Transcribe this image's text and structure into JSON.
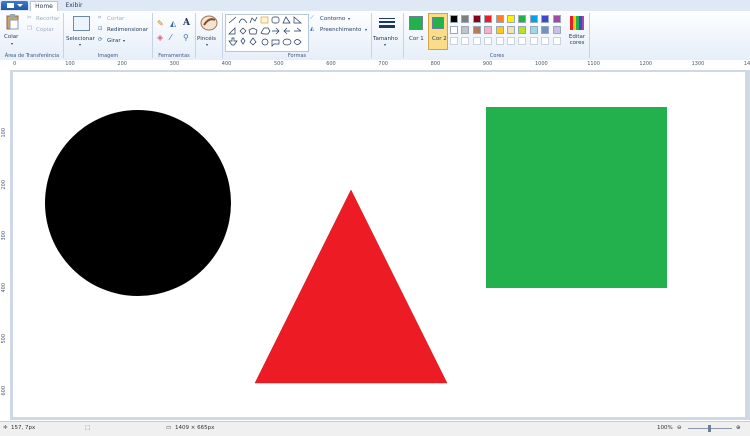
{
  "tabs": {
    "home": "Home",
    "view": "Exibir"
  },
  "clipboard": {
    "paste": "Colar",
    "cut": "Recortar",
    "copy": "Copiar",
    "group": "Área de Transferência"
  },
  "image": {
    "select": "Selecionar",
    "crop": "Cortar",
    "resize": "Redimensionar",
    "rotate": "Girar",
    "group": "Imagem"
  },
  "tools": {
    "group": "Ferramentas",
    "brushes": "Pincéis"
  },
  "shapes": {
    "outline": "Contorno",
    "fill": "Preenchimento",
    "group": "Formas"
  },
  "size": {
    "label": "Tamanho"
  },
  "colors": {
    "color1": "Cor 1",
    "color2": "Cor 2",
    "edit": "Editar cores",
    "group": "Cores",
    "color1_value": "#22b14c",
    "color2_value": "#22b14c",
    "palette": [
      "#000000",
      "#7f7f7f",
      "#880015",
      "#ed1c24",
      "#ff7f27",
      "#fff200",
      "#22b14c",
      "#00a2e8",
      "#3f48cc",
      "#a349a4",
      "#ffffff",
      "#c3c3c3",
      "#b97a57",
      "#ffaec9",
      "#ffc90e",
      "#efe4b0",
      "#b5e61d",
      "#99d9ea",
      "#7092be",
      "#c8bfe7"
    ]
  },
  "ruler": {
    "h": [
      "0",
      "100",
      "200",
      "300",
      "400",
      "500",
      "600",
      "700",
      "800",
      "900",
      "1000",
      "1100",
      "1200",
      "1300",
      "14"
    ],
    "v": [
      "100",
      "200",
      "300",
      "400",
      "500",
      "600"
    ]
  },
  "canvas_shapes": {
    "circle": "#000000",
    "triangle": "#ed1c24",
    "square": "#22b14c"
  },
  "status": {
    "cursor_pos": "157, 7px",
    "image_size": "1409 × 665px",
    "zoom": "100%"
  }
}
